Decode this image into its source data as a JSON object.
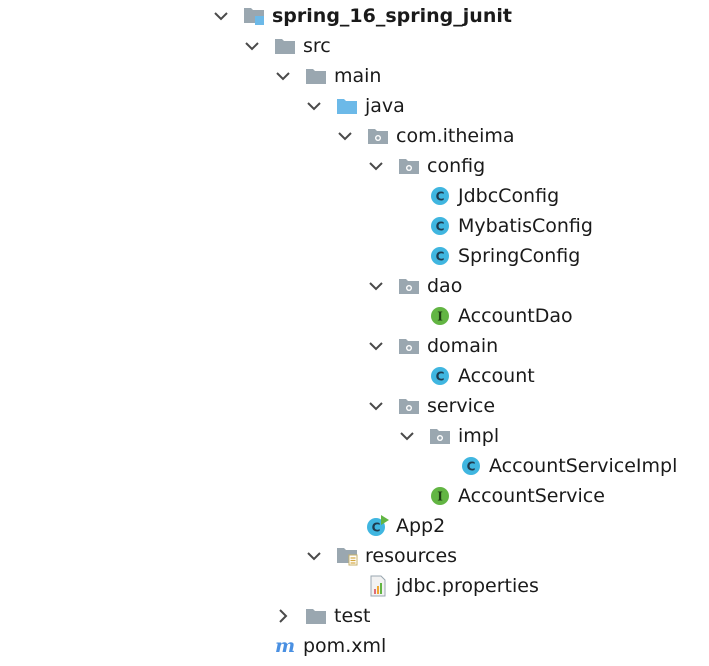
{
  "colors": {
    "folder": "#9aa7b0",
    "source_folder": "#6cb9e8",
    "class_icon": "#40b6e0",
    "interface_icon": "#62b543",
    "maven_icon": "#4a90e2",
    "chevron": "#4a4a4a"
  },
  "tree": [
    {
      "id": "project",
      "label": "spring_16_spring_junit",
      "depth": 0,
      "icon": "module-folder-icon",
      "expanded": true,
      "bold": true
    },
    {
      "id": "src",
      "label": "src",
      "depth": 1,
      "icon": "folder-icon",
      "expanded": true
    },
    {
      "id": "main",
      "label": "main",
      "depth": 2,
      "icon": "folder-icon",
      "expanded": true
    },
    {
      "id": "java",
      "label": "java",
      "depth": 3,
      "icon": "source-folder-icon",
      "expanded": true
    },
    {
      "id": "com-itheima",
      "label": "com.itheima",
      "depth": 4,
      "icon": "package-icon",
      "expanded": true
    },
    {
      "id": "config",
      "label": "config",
      "depth": 5,
      "icon": "package-icon",
      "expanded": true
    },
    {
      "id": "jdbcconfig",
      "label": "JdbcConfig",
      "depth": 6,
      "icon": "class-icon"
    },
    {
      "id": "mybatisconfig",
      "label": "MybatisConfig",
      "depth": 6,
      "icon": "class-icon"
    },
    {
      "id": "springconfig",
      "label": "SpringConfig",
      "depth": 6,
      "icon": "class-icon"
    },
    {
      "id": "dao",
      "label": "dao",
      "depth": 5,
      "icon": "package-icon",
      "expanded": true
    },
    {
      "id": "accountdao",
      "label": "AccountDao",
      "depth": 6,
      "icon": "interface-icon"
    },
    {
      "id": "domain",
      "label": "domain",
      "depth": 5,
      "icon": "package-icon",
      "expanded": true
    },
    {
      "id": "account",
      "label": "Account",
      "depth": 6,
      "icon": "class-icon"
    },
    {
      "id": "service",
      "label": "service",
      "depth": 5,
      "icon": "package-icon",
      "expanded": true
    },
    {
      "id": "impl",
      "label": "impl",
      "depth": 6,
      "icon": "package-icon",
      "expanded": true
    },
    {
      "id": "accountserviceimpl",
      "label": "AccountServiceImpl",
      "depth": 7,
      "icon": "class-icon"
    },
    {
      "id": "accountservice",
      "label": "AccountService",
      "depth": 6,
      "icon": "interface-icon"
    },
    {
      "id": "app2",
      "label": "App2",
      "depth": 4,
      "icon": "runnable-class-icon"
    },
    {
      "id": "resources",
      "label": "resources",
      "depth": 3,
      "icon": "resources-folder-icon",
      "expanded": true
    },
    {
      "id": "jdbc-properties",
      "label": "jdbc.properties",
      "depth": 4,
      "icon": "properties-file-icon"
    },
    {
      "id": "test",
      "label": "test",
      "depth": 2,
      "icon": "folder-icon",
      "expanded": false
    },
    {
      "id": "pom-xml",
      "label": "pom.xml",
      "depth": 1,
      "icon": "maven-icon"
    }
  ]
}
